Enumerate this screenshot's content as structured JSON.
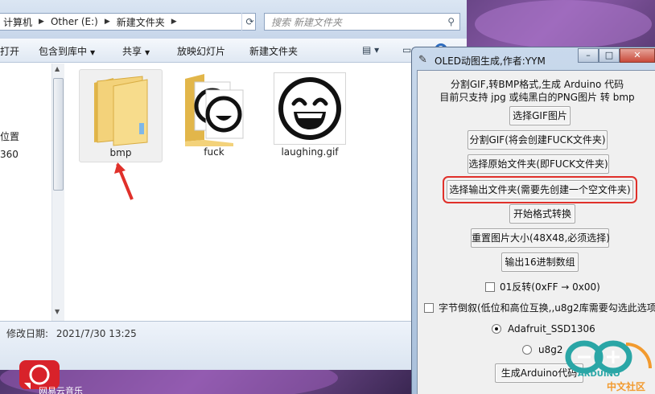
{
  "explorer": {
    "breadcrumb": [
      "计算机",
      "Other (E:)",
      "新建文件夹"
    ],
    "search_placeholder": "搜索 新建文件夹",
    "toolbar": {
      "open": "打开",
      "include_in_library": "包含到库中",
      "share": "共享",
      "slideshow": "放映幻灯片",
      "new_folder": "新建文件夹"
    },
    "nav_pane": {
      "location": "位置",
      "number": "360"
    },
    "files": [
      {
        "name": "bmp",
        "type": "folder",
        "selected": true
      },
      {
        "name": "fuck",
        "type": "folder-with-images"
      },
      {
        "name": "laughing.gif",
        "type": "image"
      }
    ],
    "details": {
      "label": "修改日期:",
      "value": "2021/7/30 13:25"
    },
    "taskbar_label": "网易云音乐"
  },
  "tool_window": {
    "title": "OLED动图生成,作者:YYM",
    "description": [
      "分割GIF,转BMP格式,生成 Arduino 代码",
      "目前只支持 jpg 或纯黑白的PNG图片 转 bmp"
    ],
    "buttons": {
      "select_gif": "选择GIF图片",
      "split_gif": "分割GIF(将会创建FUCK文件夹)",
      "select_source": "选择原始文件夹(即FUCK文件夹)",
      "select_output": "选择输出文件夹(需要先创建一个空文件夹)",
      "start_convert": "开始格式转换",
      "resize": "重置图片大小(48X48,必须选择)",
      "export_hex": "输出16进制数组",
      "generate": "生成Arduino代码"
    },
    "invert_label": "01反转(0xFF → 0x00)",
    "byte_reverse_label": "字节倒叙(低位和高位互换,,u8g2库需要勾选此选项)",
    "radio_options": [
      {
        "label": "Adafruit_SSD1306",
        "selected": true
      },
      {
        "label": "u8g2",
        "selected": false
      }
    ]
  },
  "watermark": {
    "line1": "ARDUINO",
    "line2": "中文社区"
  },
  "colors": {
    "highlight_box": "#e0302a",
    "arrow": "#e0302a",
    "accent_blue": "#2d6bbd"
  }
}
